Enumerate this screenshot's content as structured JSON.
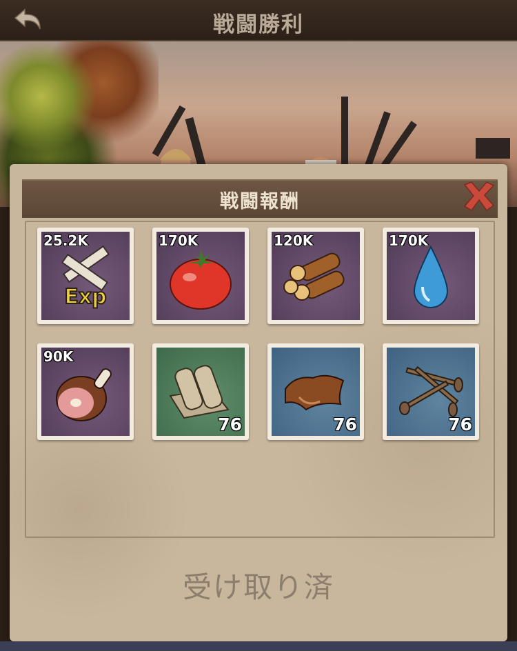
{
  "header": {
    "title": "戦闘勝利",
    "back_icon": "back-arrow-icon"
  },
  "dialog": {
    "title": "戦闘報酬",
    "close_icon": "close-x-icon",
    "claimed_label": "受け取り済",
    "items": [
      {
        "name": "exp",
        "amount": "25.2K",
        "count": "",
        "icon": "exp-guns-icon",
        "bg": "purple"
      },
      {
        "name": "food",
        "amount": "170K",
        "count": "",
        "icon": "tomato-icon",
        "bg": "purple"
      },
      {
        "name": "wood",
        "amount": "120K",
        "count": "",
        "icon": "logs-icon",
        "bg": "purple"
      },
      {
        "name": "water",
        "amount": "170K",
        "count": "",
        "icon": "water-drop-icon",
        "bg": "purple"
      },
      {
        "name": "meat",
        "amount": "90K",
        "count": "",
        "icon": "ham-icon",
        "bg": "purple"
      },
      {
        "name": "cloth",
        "amount": "",
        "count": "76",
        "icon": "cloth-rolls-icon",
        "bg": "green"
      },
      {
        "name": "leather",
        "amount": "",
        "count": "76",
        "icon": "leather-icon",
        "bg": "blue"
      },
      {
        "name": "nails",
        "amount": "",
        "count": "76",
        "icon": "nails-icon",
        "bg": "blue"
      }
    ]
  },
  "colors": {
    "purple_slot": "#5e4866",
    "green_slot": "#4b7a58",
    "blue_slot": "#4d7190",
    "panel": "#c9b79d"
  }
}
